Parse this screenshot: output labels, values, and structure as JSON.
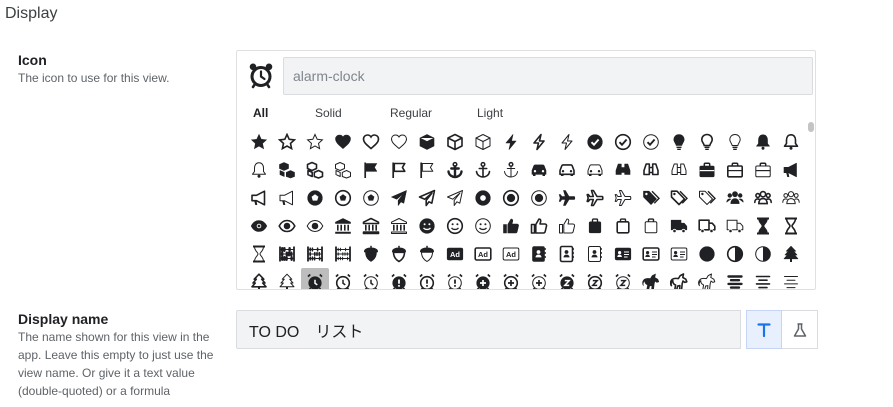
{
  "section": {
    "title": "Display"
  },
  "icon_field": {
    "label": "Icon",
    "description": "The icon to use for this view.",
    "value": "alarm-clock",
    "selected_icon": "alarm-clock-icon",
    "filter_tabs": [
      "All",
      "Solid",
      "Regular",
      "Light"
    ],
    "active_filter": "All",
    "icons": [
      [
        "star-solid-icon",
        "star-regular-icon",
        "star-light-icon",
        "heart-solid-icon",
        "heart-regular-icon",
        "heart-light-icon",
        "cube-solid-icon",
        "cube-regular-icon",
        "cube-light-icon",
        "bolt-solid-icon",
        "bolt-regular-icon",
        "bolt-light-icon",
        "check-circle-solid-icon",
        "check-circle-regular-icon",
        "check-circle-light-icon",
        "lightbulb-solid-icon",
        "lightbulb-regular-icon",
        "lightbulb-light-icon",
        "bell-solid-icon",
        "bell-regular-icon"
      ],
      [
        "bell-light-icon",
        "cubes-solid-icon",
        "cubes-regular-icon",
        "cubes-light-icon",
        "flag-solid-icon",
        "flag-regular-icon",
        "flag-light-icon",
        "anchor-solid-icon",
        "anchor-regular-icon",
        "anchor-light-icon",
        "car-solid-icon",
        "car-regular-icon",
        "car-light-icon",
        "binoculars-solid-icon",
        "binoculars-regular-icon",
        "binoculars-light-icon",
        "briefcase-solid-icon",
        "briefcase-regular-icon",
        "briefcase-light-icon",
        "bullhorn-solid-icon"
      ],
      [
        "bullhorn-regular-icon",
        "bullhorn-light-icon",
        "futbol-solid-icon",
        "futbol-regular-icon",
        "futbol-light-icon",
        "paper-plane-solid-icon",
        "paper-plane-regular-icon",
        "paper-plane-light-icon",
        "life-ring-solid-icon",
        "life-ring-regular-icon",
        "life-ring-light-icon",
        "plane-solid-icon",
        "plane-regular-icon",
        "plane-light-icon",
        "tags-solid-icon",
        "tags-regular-icon",
        "tags-light-icon",
        "users-solid-icon",
        "users-regular-icon",
        "users-light-icon"
      ],
      [
        "eye-solid-icon",
        "eye-regular-icon",
        "eye-light-icon",
        "university-solid-icon",
        "university-regular-icon",
        "university-light-icon",
        "smile-solid-icon",
        "smile-regular-icon",
        "smile-light-icon",
        "thumbs-up-solid-icon",
        "thumbs-up-regular-icon",
        "thumbs-up-light-icon",
        "suitcase-solid-icon",
        "suitcase-regular-icon",
        "suitcase-light-icon",
        "truck-solid-icon",
        "truck-regular-icon",
        "truck-light-icon",
        "hourglass-solid-icon",
        "hourglass-regular-icon"
      ],
      [
        "hourglass-light-icon",
        "abacus-solid-icon",
        "abacus-regular-icon",
        "abacus-light-icon",
        "acorn-solid-icon",
        "acorn-regular-icon",
        "acorn-light-icon",
        "ad-solid-icon",
        "ad-regular-icon",
        "ad-light-icon",
        "address-book-solid-icon",
        "address-book-regular-icon",
        "address-book-light-icon",
        "address-card-solid-icon",
        "address-card-regular-icon",
        "address-card-light-icon",
        "adjust-solid-icon",
        "adjust-regular-icon",
        "adjust-light-icon",
        "tree-solid-icon"
      ],
      [
        "tree-regular-icon",
        "tree-light-icon",
        "alarm-clock-solid-icon",
        "alarm-clock-regular-icon",
        "alarm-clock-light-icon",
        "alarm-exclamation-solid-icon",
        "alarm-exclamation-regular-icon",
        "alarm-exclamation-light-icon",
        "alarm-plus-solid-icon",
        "alarm-plus-regular-icon",
        "alarm-plus-light-icon",
        "alarm-snooze-solid-icon",
        "alarm-snooze-regular-icon",
        "alarm-snooze-light-icon",
        "alicorn-solid-icon",
        "alicorn-regular-icon",
        "alicorn-light-icon",
        "align-center-solid-icon",
        "align-center-regular-icon",
        "align-center-light-icon"
      ]
    ],
    "selected_grid_icon": "alarm-clock-solid-icon"
  },
  "display_name_field": {
    "label": "Display name",
    "description": "The name shown for this view in the app. Leave this empty to just use the view name. Or give it a text value (double-quoted) or a formula",
    "value": "TO DO　リスト",
    "modes": [
      "text-mode-icon",
      "formula-mode-icon"
    ],
    "active_mode": "text-mode-icon"
  },
  "colors": {
    "accent": "#1a73e8",
    "icon": "#202124",
    "selected_bg": "#bdbdbd",
    "input_bg": "#f1f3f4"
  }
}
